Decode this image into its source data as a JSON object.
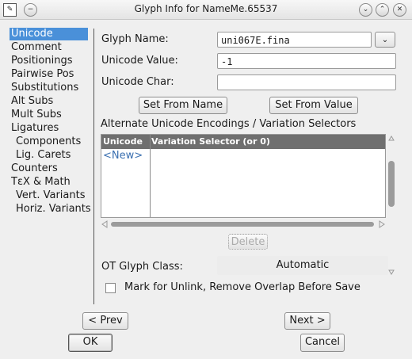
{
  "window": {
    "title": "Glyph Info for NameMe.65537",
    "icon": "app-icon",
    "buttons": [
      "minimize-icon",
      "maximize-icon",
      "close-icon"
    ]
  },
  "sidebar": {
    "items": [
      {
        "label": "Unicode",
        "selected": true
      },
      {
        "label": "Comment"
      },
      {
        "label": "Positionings"
      },
      {
        "label": "Pairwise Pos"
      },
      {
        "label": "Substitutions"
      },
      {
        "label": "Alt Subs"
      },
      {
        "label": "Mult Subs"
      },
      {
        "label": "Ligatures"
      },
      {
        "label": "Components"
      },
      {
        "label": "Lig. Carets"
      },
      {
        "label": "Counters"
      },
      {
        "label": "TεX & Math"
      },
      {
        "label": "Vert. Variants"
      },
      {
        "label": "Horiz. Variants"
      }
    ]
  },
  "form": {
    "glyph_name_label": "Glyph Name:",
    "glyph_name_value": "uni067E.fina",
    "unicode_value_label": "Unicode Value:",
    "unicode_value_value": "-1",
    "unicode_char_label": "Unicode Char:",
    "unicode_char_value": "",
    "set_from_name": "Set From Name",
    "set_from_value": "Set From Value",
    "alt_label": "Alternate Unicode Encodings / Variation Selectors",
    "table_headers": [
      "Unicode",
      "Variation Selector (or 0)"
    ],
    "new_row": "<New>",
    "delete": "Delete",
    "ot_class_label": "OT Glyph Class:",
    "ot_class_value": "Automatic",
    "mark_unlink_label": "Mark for Unlink, Remove Overlap Before Save"
  },
  "footer": {
    "prev": "< Prev",
    "next": "Next >",
    "ok": "OK",
    "cancel": "Cancel"
  }
}
